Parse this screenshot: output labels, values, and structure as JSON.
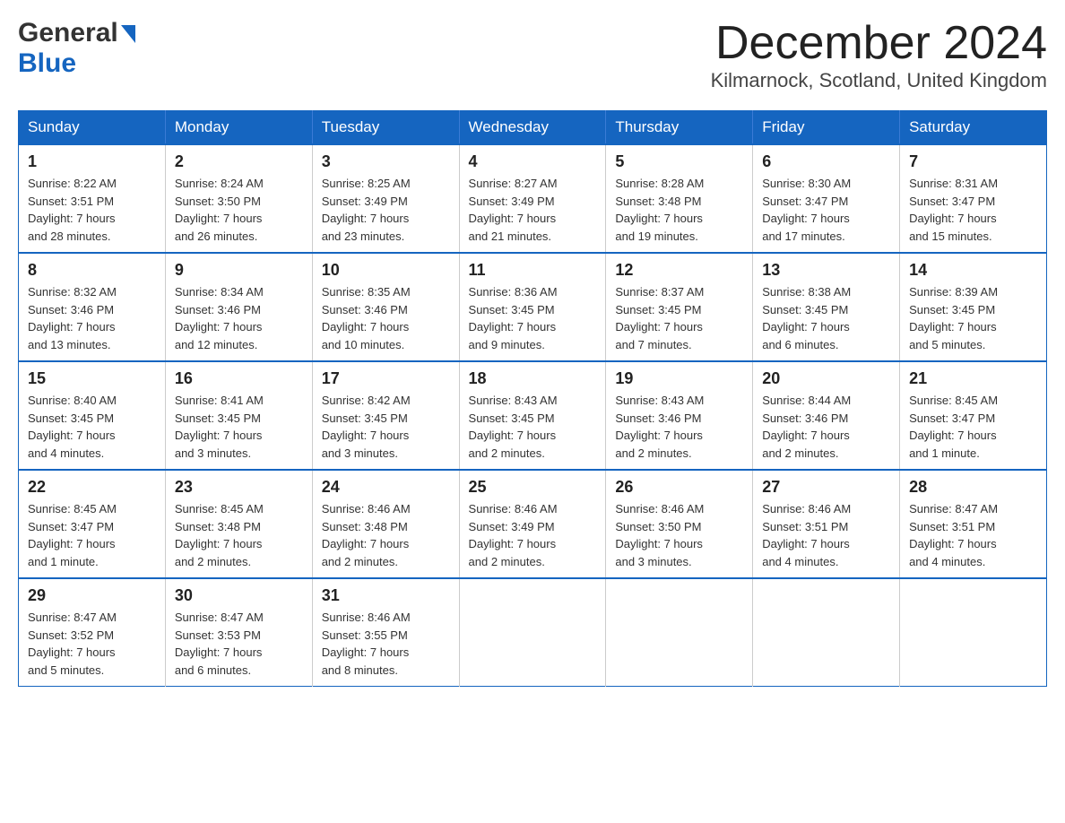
{
  "header": {
    "logo_general": "General",
    "logo_blue": "Blue",
    "month_title": "December 2024",
    "location": "Kilmarnock, Scotland, United Kingdom"
  },
  "weekdays": [
    "Sunday",
    "Monday",
    "Tuesday",
    "Wednesday",
    "Thursday",
    "Friday",
    "Saturday"
  ],
  "weeks": [
    [
      {
        "day": "1",
        "sunrise": "8:22 AM",
        "sunset": "3:51 PM",
        "daylight": "7 hours and 28 minutes."
      },
      {
        "day": "2",
        "sunrise": "8:24 AM",
        "sunset": "3:50 PM",
        "daylight": "7 hours and 26 minutes."
      },
      {
        "day": "3",
        "sunrise": "8:25 AM",
        "sunset": "3:49 PM",
        "daylight": "7 hours and 23 minutes."
      },
      {
        "day": "4",
        "sunrise": "8:27 AM",
        "sunset": "3:49 PM",
        "daylight": "7 hours and 21 minutes."
      },
      {
        "day": "5",
        "sunrise": "8:28 AM",
        "sunset": "3:48 PM",
        "daylight": "7 hours and 19 minutes."
      },
      {
        "day": "6",
        "sunrise": "8:30 AM",
        "sunset": "3:47 PM",
        "daylight": "7 hours and 17 minutes."
      },
      {
        "day": "7",
        "sunrise": "8:31 AM",
        "sunset": "3:47 PM",
        "daylight": "7 hours and 15 minutes."
      }
    ],
    [
      {
        "day": "8",
        "sunrise": "8:32 AM",
        "sunset": "3:46 PM",
        "daylight": "7 hours and 13 minutes."
      },
      {
        "day": "9",
        "sunrise": "8:34 AM",
        "sunset": "3:46 PM",
        "daylight": "7 hours and 12 minutes."
      },
      {
        "day": "10",
        "sunrise": "8:35 AM",
        "sunset": "3:46 PM",
        "daylight": "7 hours and 10 minutes."
      },
      {
        "day": "11",
        "sunrise": "8:36 AM",
        "sunset": "3:45 PM",
        "daylight": "7 hours and 9 minutes."
      },
      {
        "day": "12",
        "sunrise": "8:37 AM",
        "sunset": "3:45 PM",
        "daylight": "7 hours and 7 minutes."
      },
      {
        "day": "13",
        "sunrise": "8:38 AM",
        "sunset": "3:45 PM",
        "daylight": "7 hours and 6 minutes."
      },
      {
        "day": "14",
        "sunrise": "8:39 AM",
        "sunset": "3:45 PM",
        "daylight": "7 hours and 5 minutes."
      }
    ],
    [
      {
        "day": "15",
        "sunrise": "8:40 AM",
        "sunset": "3:45 PM",
        "daylight": "7 hours and 4 minutes."
      },
      {
        "day": "16",
        "sunrise": "8:41 AM",
        "sunset": "3:45 PM",
        "daylight": "7 hours and 3 minutes."
      },
      {
        "day": "17",
        "sunrise": "8:42 AM",
        "sunset": "3:45 PM",
        "daylight": "7 hours and 3 minutes."
      },
      {
        "day": "18",
        "sunrise": "8:43 AM",
        "sunset": "3:45 PM",
        "daylight": "7 hours and 2 minutes."
      },
      {
        "day": "19",
        "sunrise": "8:43 AM",
        "sunset": "3:46 PM",
        "daylight": "7 hours and 2 minutes."
      },
      {
        "day": "20",
        "sunrise": "8:44 AM",
        "sunset": "3:46 PM",
        "daylight": "7 hours and 2 minutes."
      },
      {
        "day": "21",
        "sunrise": "8:45 AM",
        "sunset": "3:47 PM",
        "daylight": "7 hours and 1 minute."
      }
    ],
    [
      {
        "day": "22",
        "sunrise": "8:45 AM",
        "sunset": "3:47 PM",
        "daylight": "7 hours and 1 minute."
      },
      {
        "day": "23",
        "sunrise": "8:45 AM",
        "sunset": "3:48 PM",
        "daylight": "7 hours and 2 minutes."
      },
      {
        "day": "24",
        "sunrise": "8:46 AM",
        "sunset": "3:48 PM",
        "daylight": "7 hours and 2 minutes."
      },
      {
        "day": "25",
        "sunrise": "8:46 AM",
        "sunset": "3:49 PM",
        "daylight": "7 hours and 2 minutes."
      },
      {
        "day": "26",
        "sunrise": "8:46 AM",
        "sunset": "3:50 PM",
        "daylight": "7 hours and 3 minutes."
      },
      {
        "day": "27",
        "sunrise": "8:46 AM",
        "sunset": "3:51 PM",
        "daylight": "7 hours and 4 minutes."
      },
      {
        "day": "28",
        "sunrise": "8:47 AM",
        "sunset": "3:51 PM",
        "daylight": "7 hours and 4 minutes."
      }
    ],
    [
      {
        "day": "29",
        "sunrise": "8:47 AM",
        "sunset": "3:52 PM",
        "daylight": "7 hours and 5 minutes."
      },
      {
        "day": "30",
        "sunrise": "8:47 AM",
        "sunset": "3:53 PM",
        "daylight": "7 hours and 6 minutes."
      },
      {
        "day": "31",
        "sunrise": "8:46 AM",
        "sunset": "3:55 PM",
        "daylight": "7 hours and 8 minutes."
      },
      null,
      null,
      null,
      null
    ]
  ],
  "labels": {
    "sunrise": "Sunrise:",
    "sunset": "Sunset:",
    "daylight": "Daylight:"
  }
}
